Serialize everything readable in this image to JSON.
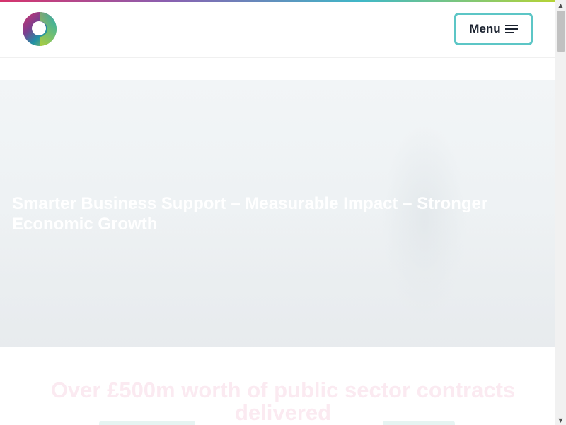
{
  "header": {
    "logo_icon": "ring-logo-icon",
    "menu_label": "Menu",
    "menu_icon": "hamburger-icon",
    "accent_color": "#5cc6c6"
  },
  "hero": {
    "title": "Smarter Business Support – Measurable Impact – Stronger Economic Growth"
  },
  "stats": {
    "heading": "Over £500m worth of public sector contracts delivered"
  },
  "colors": {
    "gradient": [
      "#d6336c",
      "#8a5fb0",
      "#3fb8c8",
      "#b6d334"
    ],
    "heading_color": "#fbeaf1"
  }
}
